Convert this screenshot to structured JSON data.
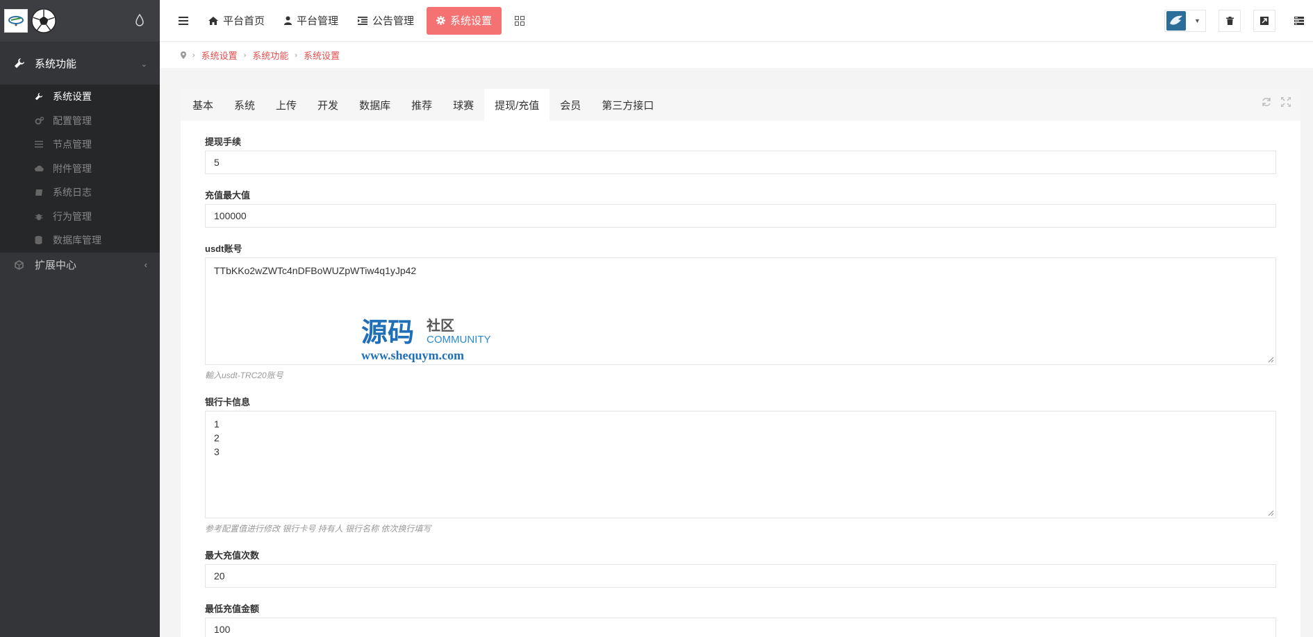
{
  "sidebar": {
    "group1": {
      "label": "系统功能",
      "icon": "wrench-icon"
    },
    "items": [
      {
        "label": "系统设置",
        "icon": "wrench-icon",
        "active": true
      },
      {
        "label": "配置管理",
        "icon": "cogs-icon"
      },
      {
        "label": "节点管理",
        "icon": "list-icon"
      },
      {
        "label": "附件管理",
        "icon": "cloud-upload-icon"
      },
      {
        "label": "系统日志",
        "icon": "book-icon"
      },
      {
        "label": "行为管理",
        "icon": "bug-icon"
      },
      {
        "label": "数据库管理",
        "icon": "database-icon"
      }
    ],
    "group2": {
      "label": "扩展中心",
      "icon": "cubes-icon"
    }
  },
  "topbar": {
    "tabs": [
      {
        "label": "平台首页",
        "icon": "home-icon"
      },
      {
        "label": "平台管理",
        "icon": "user-icon"
      },
      {
        "label": "公告管理",
        "icon": "indent-icon"
      },
      {
        "label": "系统设置",
        "icon": "gear-icon",
        "active": true
      }
    ]
  },
  "breadcrumb": [
    "系统设置",
    "系统功能",
    "系统设置"
  ],
  "panel_tabs": [
    "基本",
    "系统",
    "上传",
    "开发",
    "数据库",
    "推荐",
    "球赛",
    "提现/充值",
    "会员",
    "第三方接口"
  ],
  "active_panel_tab": "提现/充值",
  "form": {
    "fee": {
      "label": "提现手续",
      "value": "5"
    },
    "max_recharge": {
      "label": "充值最大值",
      "value": "100000"
    },
    "usdt": {
      "label": "usdt账号",
      "value": "TTbKKo2wZWTc4nDFBoWUZpWTiw4q1yJp42",
      "help": "輸入usdt-TRC20账号"
    },
    "bank": {
      "label": "银行卡信息",
      "value": "1\n2\n3",
      "help": "参考配置值进行修改 银行卡号 持有人 银行名称 依次换行填写"
    },
    "max_times": {
      "label": "最大充值次数",
      "value": "20"
    },
    "min_amount": {
      "label": "最低充值金额",
      "value": "100"
    }
  },
  "watermark": {
    "big": "源码",
    "small": "社区",
    "en": "COMMUNITY",
    "url": "www.shequym.com"
  },
  "colors": {
    "accent": "#f47272",
    "link": "#e64d4d",
    "sidebar": "#333538"
  }
}
